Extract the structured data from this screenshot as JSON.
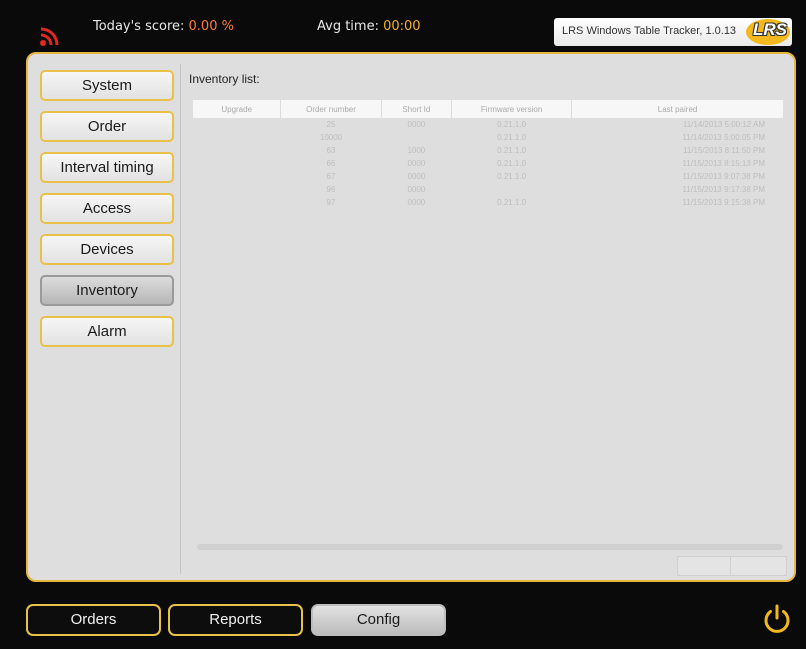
{
  "header": {
    "score_label": "Today's score:",
    "score_value": "0.00 %",
    "avg_label": "Avg time:",
    "avg_value": "00:00",
    "version": "LRS Windows Table Tracker, 1.0.13",
    "logo_text": "LRS"
  },
  "sidebar": {
    "items": [
      {
        "label": "System"
      },
      {
        "label": "Order"
      },
      {
        "label": "Interval timing"
      },
      {
        "label": "Access"
      },
      {
        "label": "Devices"
      },
      {
        "label": "Inventory",
        "active": true
      },
      {
        "label": "Alarm"
      }
    ]
  },
  "inventory": {
    "title": "Inventory list:",
    "columns": [
      "Upgrade",
      "Order number",
      "Short Id",
      "Firmware version",
      "Last paired"
    ],
    "rows": [
      [
        "",
        "25",
        "0000",
        "0.21.1.0",
        "11/14/2013 5:00:12 AM"
      ],
      [
        "",
        "10000",
        "",
        "0.21.1.0",
        "11/14/2013 5:00:05 PM"
      ],
      [
        "",
        "63",
        "1000",
        "0.21.1.0",
        "11/15/2013 8:11:50 PM"
      ],
      [
        "",
        "66",
        "0000",
        "0.21.1.0",
        "11/15/2013 8:15:13 PM"
      ],
      [
        "",
        "67",
        "0000",
        "0.21.1.0",
        "11/15/2013 9:07:38 PM"
      ],
      [
        "",
        "96",
        "0000",
        "",
        "11/15/2013 9:17:38 PM"
      ],
      [
        "",
        "97",
        "0000",
        "0.21.1.0",
        "11/15/2013 9:15:38 PM"
      ]
    ]
  },
  "bottom_nav": {
    "orders": "Orders",
    "reports": "Reports",
    "config": "Config"
  },
  "colors": {
    "accent": "#e9c14a",
    "score": "#ff7a3a",
    "avg": "#f2b020",
    "wifi": "#e02820"
  },
  "icons": [
    "wifi-icon",
    "lrs-logo",
    "power-icon"
  ]
}
